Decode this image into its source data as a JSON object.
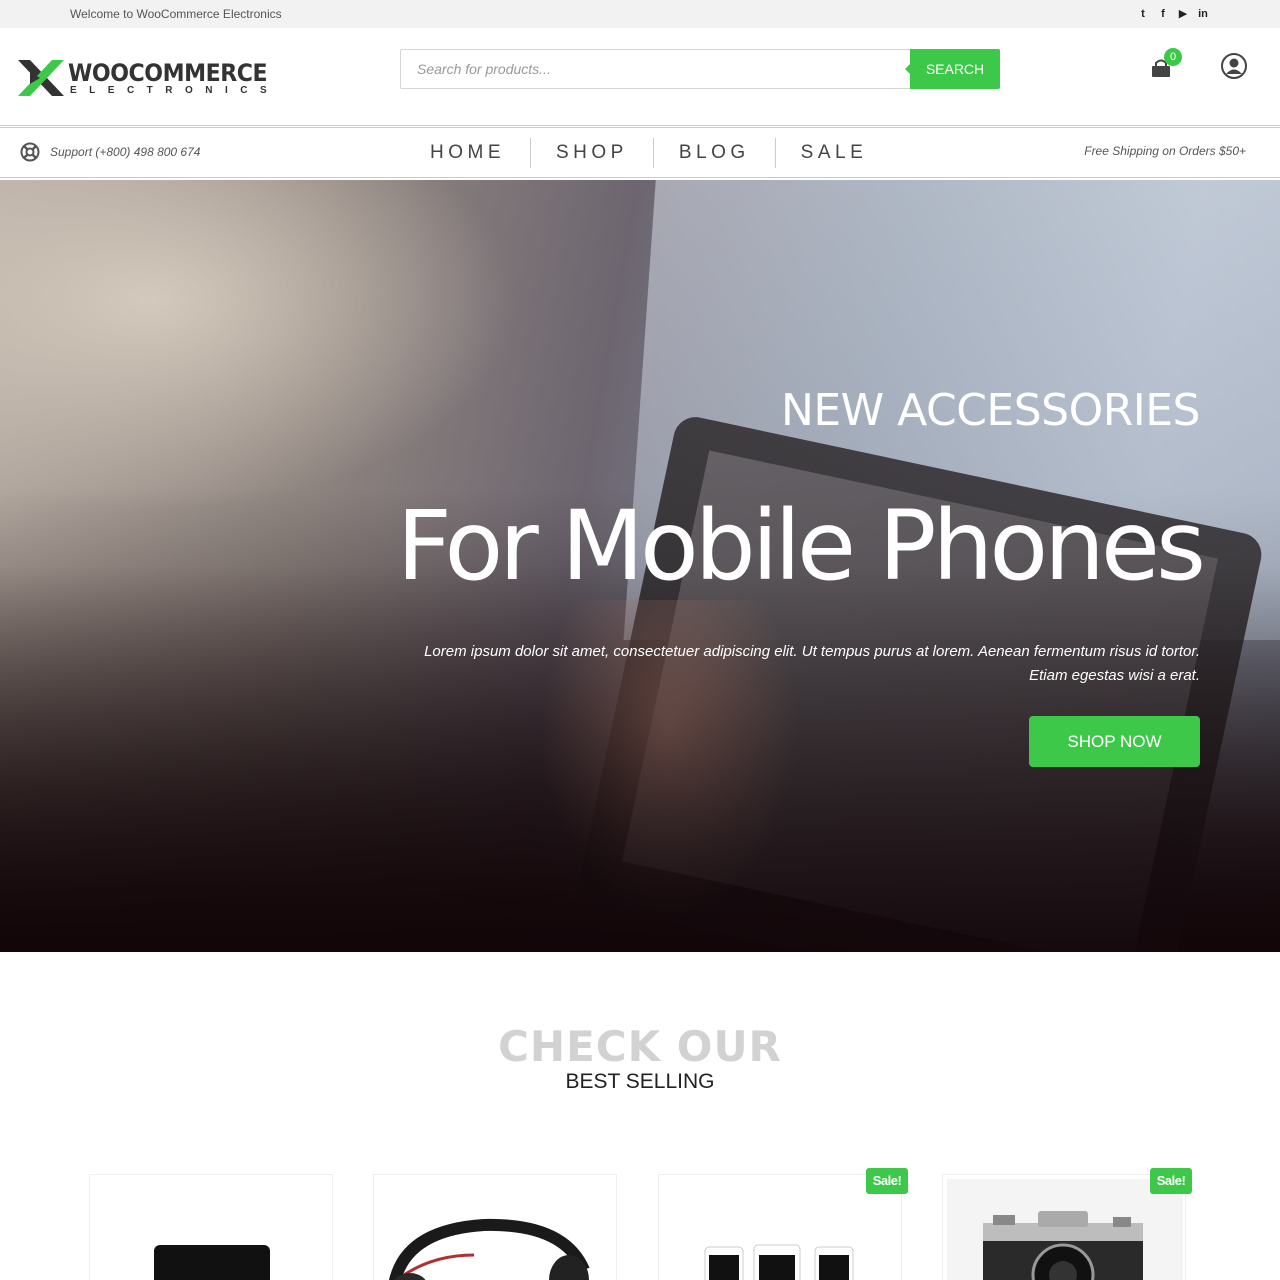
{
  "topbar": {
    "welcome": "Welcome to WooCommerce Electronics",
    "social": [
      {
        "name": "twitter-icon",
        "glyph": "t"
      },
      {
        "name": "facebook-icon",
        "glyph": "f"
      },
      {
        "name": "youtube-icon",
        "glyph": "▶"
      },
      {
        "name": "linkedin-icon",
        "glyph": "in"
      }
    ]
  },
  "header": {
    "logo_main": "WOOCOMMERCE",
    "logo_sub": "ELECTRONICS",
    "search_placeholder": "Search for products...",
    "search_button": "SEARCH",
    "cart_count": "0"
  },
  "navbar": {
    "support": "Support (+800) 498 800 674",
    "items": [
      "HOME",
      "SHOP",
      "BLOG",
      "SALE"
    ],
    "shipping": "Free Shipping on Orders $50+"
  },
  "hero": {
    "kicker": "NEW ACCESSORIES",
    "headline": "For Mobile Phones",
    "description_line1": "Lorem ipsum dolor sit amet, consectetuer adipiscing elit. Ut tempus purus at lorem. Aenean fermentum risus id tortor.",
    "description_line2": "Etiam egestas wisi a erat.",
    "cta": "SHOP NOW"
  },
  "best_selling": {
    "title": "CHECK OUR",
    "subtitle": "BEST SELLING",
    "sale_badge": "Sale!",
    "products": [
      {
        "image": "laptop-image",
        "on_sale": false
      },
      {
        "image": "headphones-image",
        "on_sale": false
      },
      {
        "image": "tablets-image",
        "on_sale": true
      },
      {
        "image": "camera-image",
        "on_sale": true
      }
    ]
  },
  "colors": {
    "accent": "#3ec84a",
    "topbar_bg": "#f2f2f2",
    "title_gray": "#d2d2d2"
  }
}
